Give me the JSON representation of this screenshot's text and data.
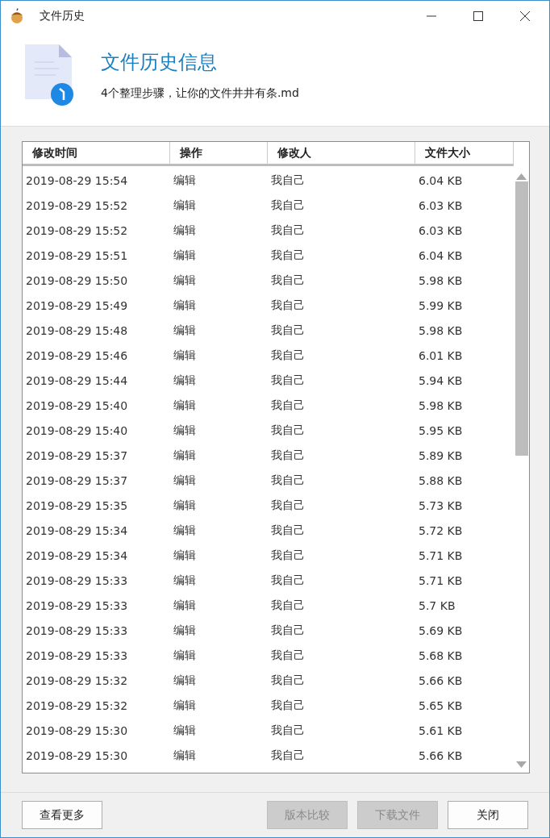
{
  "window": {
    "title": "文件历史"
  },
  "header": {
    "title": "文件历史信息",
    "filename": "4个整理步骤，让你的文件井井有条.md"
  },
  "table": {
    "columns": [
      "修改时间",
      "操作",
      "修改人",
      "文件大小"
    ],
    "rows": [
      [
        "2019-08-29 15:54",
        "编辑",
        "我自己",
        "6.04 KB"
      ],
      [
        "2019-08-29 15:52",
        "编辑",
        "我自己",
        "6.03 KB"
      ],
      [
        "2019-08-29 15:52",
        "编辑",
        "我自己",
        "6.03 KB"
      ],
      [
        "2019-08-29 15:51",
        "编辑",
        "我自己",
        "6.04 KB"
      ],
      [
        "2019-08-29 15:50",
        "编辑",
        "我自己",
        "5.98 KB"
      ],
      [
        "2019-08-29 15:49",
        "编辑",
        "我自己",
        "5.99 KB"
      ],
      [
        "2019-08-29 15:48",
        "编辑",
        "我自己",
        "5.98 KB"
      ],
      [
        "2019-08-29 15:46",
        "编辑",
        "我自己",
        "6.01 KB"
      ],
      [
        "2019-08-29 15:44",
        "编辑",
        "我自己",
        "5.94 KB"
      ],
      [
        "2019-08-29 15:40",
        "编辑",
        "我自己",
        "5.98 KB"
      ],
      [
        "2019-08-29 15:40",
        "编辑",
        "我自己",
        "5.95 KB"
      ],
      [
        "2019-08-29 15:37",
        "编辑",
        "我自己",
        "5.89 KB"
      ],
      [
        "2019-08-29 15:37",
        "编辑",
        "我自己",
        "5.88 KB"
      ],
      [
        "2019-08-29 15:35",
        "编辑",
        "我自己",
        "5.73 KB"
      ],
      [
        "2019-08-29 15:34",
        "编辑",
        "我自己",
        "5.72 KB"
      ],
      [
        "2019-08-29 15:34",
        "编辑",
        "我自己",
        "5.71 KB"
      ],
      [
        "2019-08-29 15:33",
        "编辑",
        "我自己",
        "5.71 KB"
      ],
      [
        "2019-08-29 15:33",
        "编辑",
        "我自己",
        "5.7 KB"
      ],
      [
        "2019-08-29 15:33",
        "编辑",
        "我自己",
        "5.69 KB"
      ],
      [
        "2019-08-29 15:33",
        "编辑",
        "我自己",
        "5.68 KB"
      ],
      [
        "2019-08-29 15:32",
        "编辑",
        "我自己",
        "5.66 KB"
      ],
      [
        "2019-08-29 15:32",
        "编辑",
        "我自己",
        "5.65 KB"
      ],
      [
        "2019-08-29 15:30",
        "编辑",
        "我自己",
        "5.61 KB"
      ],
      [
        "2019-08-29 15:30",
        "编辑",
        "我自己",
        "5.66 KB"
      ]
    ]
  },
  "buttons": [
    {
      "label": "查看更多",
      "disabled": false
    },
    {
      "label": "版本比较",
      "disabled": true
    },
    {
      "label": "下载文件",
      "disabled": true
    },
    {
      "label": "关闭",
      "disabled": false
    }
  ]
}
